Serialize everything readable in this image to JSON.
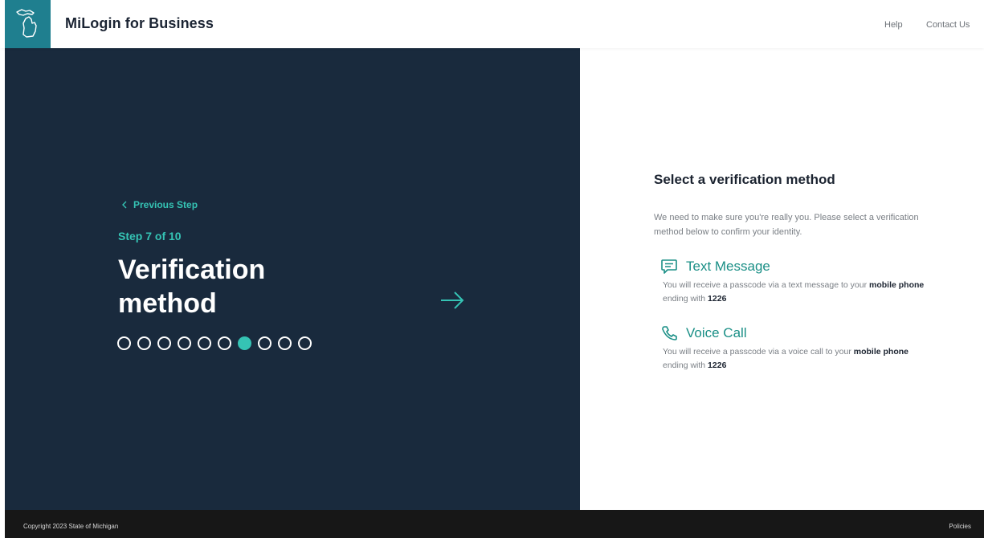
{
  "header": {
    "brand": "MiLogin for Business",
    "links": [
      "Help",
      "Contact Us"
    ]
  },
  "left": {
    "previous_step": "Previous Step",
    "step_indicator": "Step 7 of 10",
    "title_line1": "Verification",
    "title_line2": "method",
    "steps_total": 10,
    "current_step": 7
  },
  "right": {
    "title": "Select a verification method",
    "description": "We need to make sure you're really you. Please select a verification method below to confirm your identity.",
    "options": [
      {
        "icon": "message-icon",
        "label": "Text Message",
        "desc_prefix": "You will receive a passcode via a text message to your ",
        "desc_bold1": "mobile phone",
        "desc_middle": " ending with ",
        "desc_bold2": "1226"
      },
      {
        "icon": "phone-icon",
        "label": "Voice Call",
        "desc_prefix": "You will receive a passcode via a voice call to your ",
        "desc_bold1": "mobile phone",
        "desc_middle": " ending with ",
        "desc_bold2": "1226"
      }
    ]
  },
  "footer": {
    "copyright": "Copyright 2023 State of Michigan",
    "policies": "Policies"
  },
  "colors": {
    "accent": "#35c3b4",
    "panel": "#192a3d",
    "logo_bg": "#1f7f8f",
    "footer": "#171717"
  }
}
